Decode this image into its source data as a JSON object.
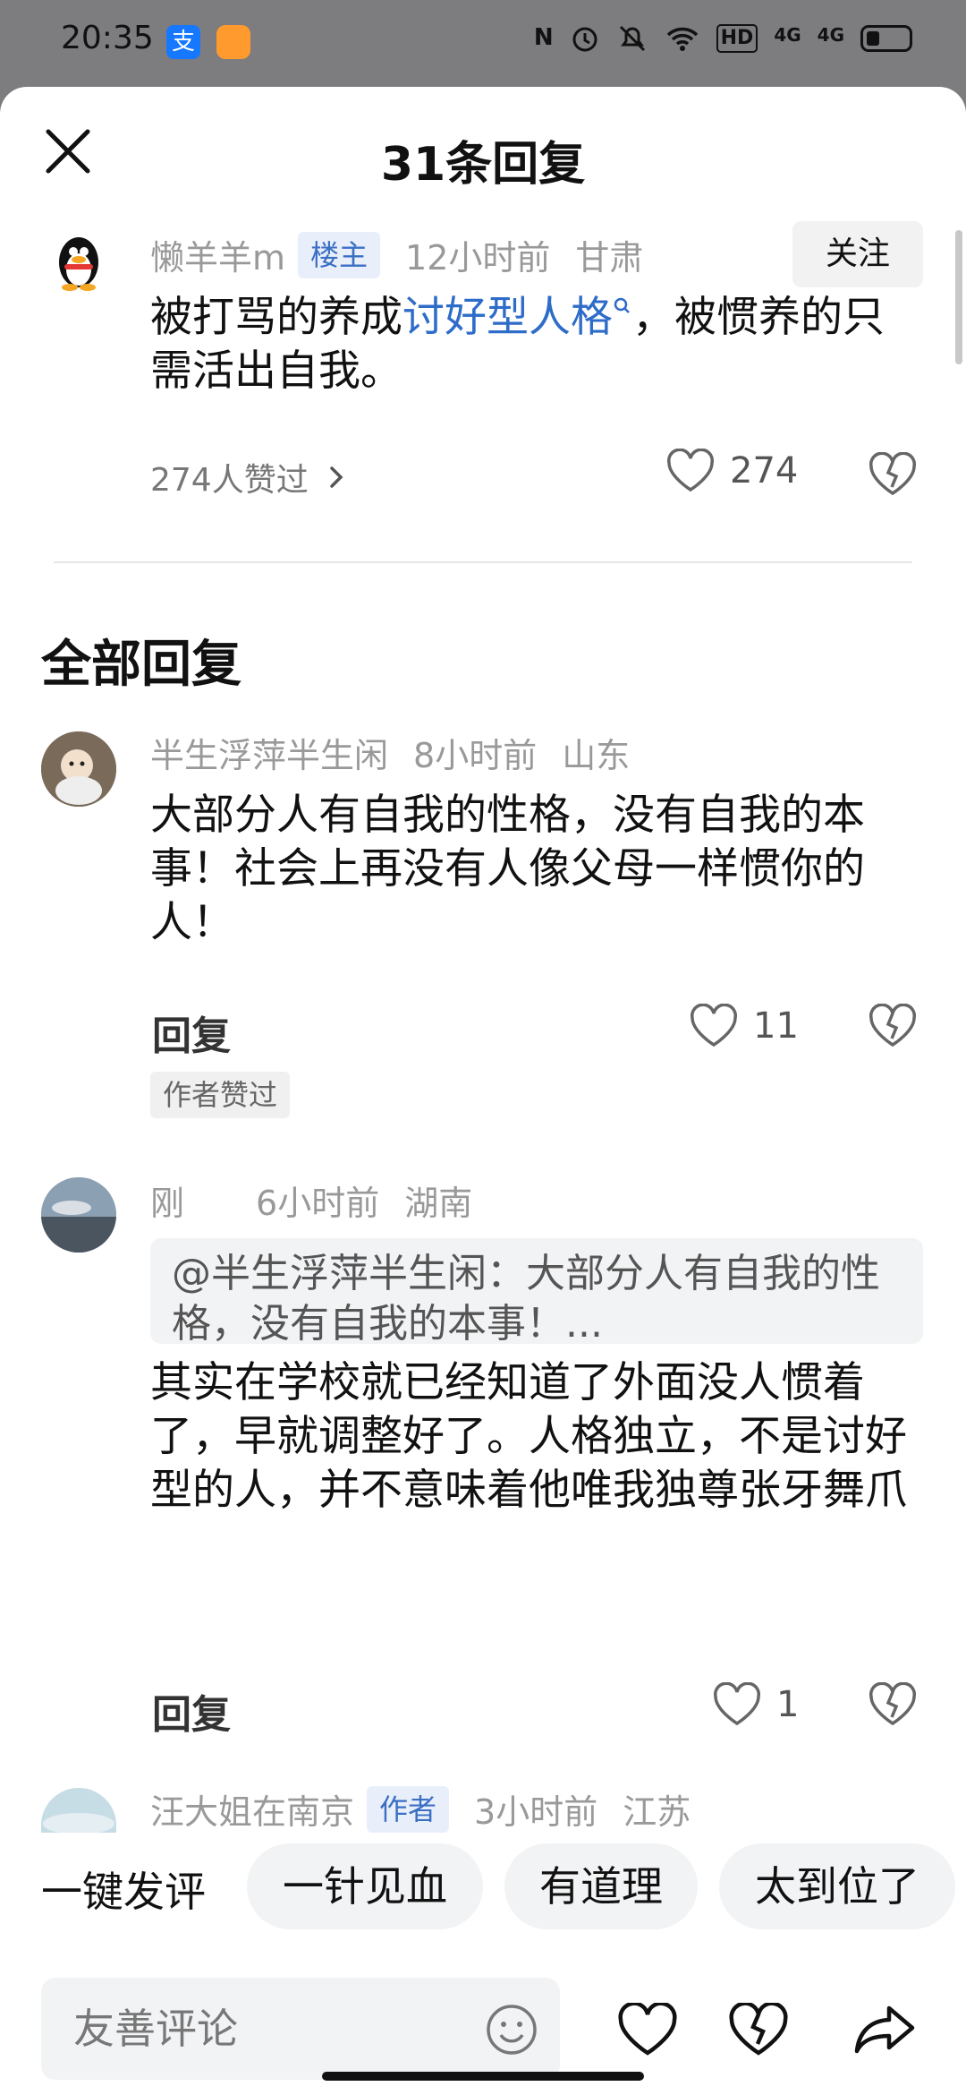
{
  "status_bar": {
    "time": "20:35",
    "app1_icon": "alipay-icon",
    "app2_icon": "app-icon",
    "nfc": "N",
    "hd": "HD",
    "signal_a": "4G",
    "signal_b": "4G"
  },
  "header": {
    "title": "31条回复"
  },
  "main_comment": {
    "user": "懒羊羊m",
    "badge": "楼主",
    "time": "12小时前",
    "location": "甘肃",
    "follow_label": "关注",
    "text_before": "被打骂的养成",
    "link_text": "讨好型人格",
    "text_after": "，被惯养的只需活出自我。",
    "likers_text": "274人赞过",
    "like_count": "274"
  },
  "section_title": "全部回复",
  "replies": [
    {
      "user": "半生浮萍半生闲",
      "time": "8小时前",
      "location": "山东",
      "text": "大部分人有自我的性格，没有自我的本事！社会上再没有人像父母一样惯你的人！",
      "reply_label": "回复",
      "like_count": "11",
      "tag": "作者赞过"
    },
    {
      "user": "刚",
      "time": "6小时前",
      "location": "湖南",
      "quote": "@半生浮萍半生闲：大部分人有自我的性格，没有自我的本事！...",
      "text": "其实在学校就已经知道了外面没人惯着了，早就调整好了。人格独立，不是讨好型的人，并不意味着他唯我独尊张牙舞爪",
      "reply_label": "回复",
      "like_count": "1"
    },
    {
      "user": "汪大姐在南京",
      "badge": "作者",
      "time": "3小时前",
      "location": "江苏"
    }
  ],
  "quick_reply": {
    "label": "一键发评",
    "chips": [
      "一针见血",
      "有道理",
      "太到位了"
    ]
  },
  "input": {
    "placeholder": "友善评论"
  },
  "colors": {
    "link": "#2d6cc8",
    "badge_bg": "#e9effa",
    "muted": "#999999"
  }
}
